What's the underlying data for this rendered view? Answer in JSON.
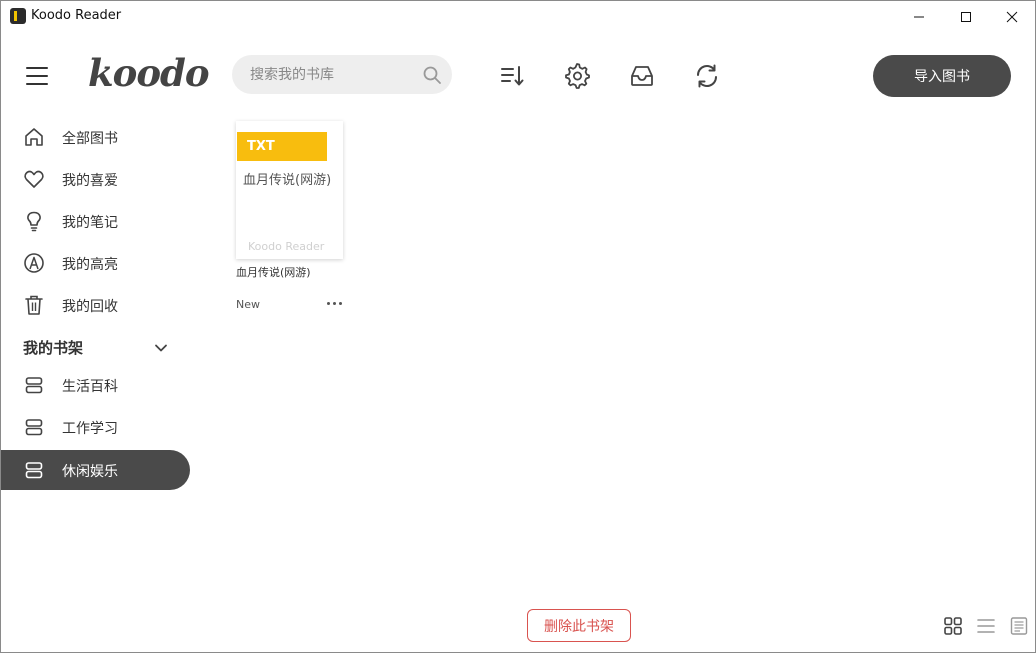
{
  "window": {
    "title": "Koodo Reader",
    "controls": [
      "minimize-icon",
      "maximize-icon",
      "close-icon"
    ]
  },
  "header": {
    "logo": "koodo",
    "search_placeholder": "搜索我的书库",
    "toolbar_icons": [
      "sort-icon",
      "gear-icon",
      "inbox-icon",
      "sync-icon"
    ],
    "import_label": "导入图书"
  },
  "sidebar": {
    "items": [
      {
        "label": "全部图书",
        "icon": "home-icon"
      },
      {
        "label": "我的喜爱",
        "icon": "heart-icon"
      },
      {
        "label": "我的笔记",
        "icon": "lightbulb-icon"
      },
      {
        "label": "我的高亮",
        "icon": "highlight-icon"
      },
      {
        "label": "我的回收",
        "icon": "trash-icon"
      }
    ],
    "shelf_header": "我的书架",
    "shelves": [
      {
        "label": "生活百科",
        "icon": "shelf-icon",
        "active": false
      },
      {
        "label": "工作学习",
        "icon": "shelf-icon",
        "active": false
      },
      {
        "label": "休闲娱乐",
        "icon": "shelf-icon",
        "active": true
      }
    ]
  },
  "books": [
    {
      "format": "TXT",
      "cover_title": "血月传说(网游)",
      "watermark": "Koodo Reader",
      "name": "血月传说(网游)",
      "status": "New"
    }
  ],
  "footer": {
    "delete_shelf_label": "删除此书架",
    "view_modes": [
      "grid-view-icon",
      "list-view-icon",
      "cover-view-icon"
    ]
  },
  "colors": {
    "accent_dark": "#4a4a4a",
    "format_badge": "#f8bd0e",
    "danger": "#d9534f"
  }
}
